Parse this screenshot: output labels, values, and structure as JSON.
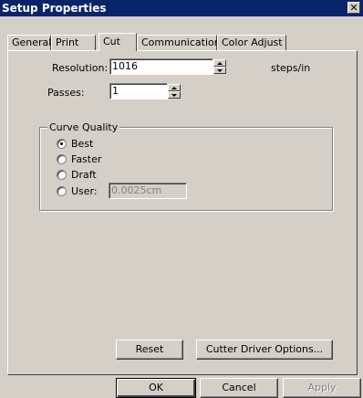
{
  "window": {
    "title": "Setup Properties",
    "close_glyph": "✕"
  },
  "tabs": [
    {
      "label": "General"
    },
    {
      "label": "Print"
    },
    {
      "label": "Cut",
      "active": true
    },
    {
      "label": "Communication"
    },
    {
      "label": "Color Adjust"
    }
  ],
  "cut": {
    "resolution_label": "Resolution:",
    "resolution_value": "1016",
    "resolution_unit": "steps/in",
    "passes_label": "Passes:",
    "passes_value": "1",
    "curve_quality": {
      "title": "Curve Quality",
      "options": [
        {
          "label": "Best",
          "checked": true
        },
        {
          "label": "Faster",
          "checked": false
        },
        {
          "label": "Draft",
          "checked": false
        },
        {
          "label": "User:",
          "checked": false
        }
      ],
      "user_value": "0.0025cm"
    },
    "reset_label": "Reset",
    "cutter_driver_label": "Cutter Driver Options..."
  },
  "footer": {
    "ok_label": "OK",
    "cancel_label": "Cancel",
    "apply_label": "Apply"
  },
  "colors": {
    "titlebar": "#0a246a",
    "face": "#d4d0c8"
  }
}
